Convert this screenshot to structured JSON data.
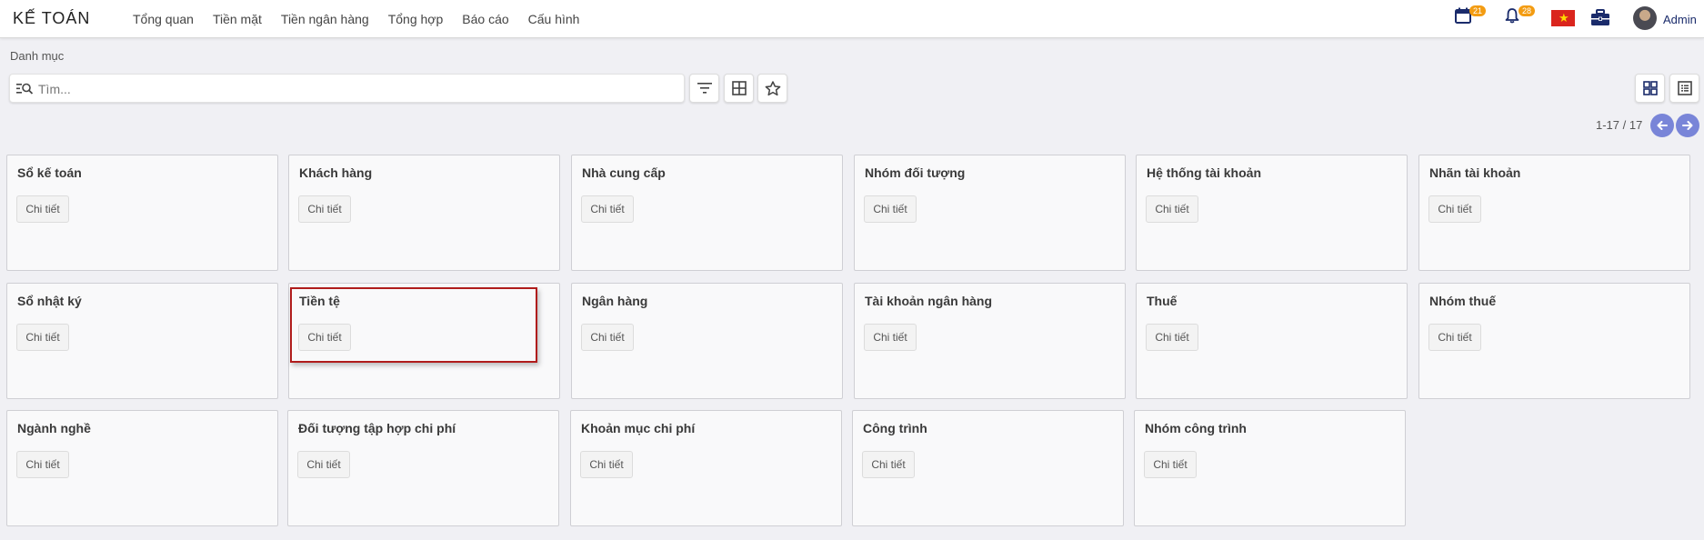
{
  "app": {
    "title": "KẾ TOÁN"
  },
  "menu": [
    {
      "label": "Tổng quan"
    },
    {
      "label": "Tiền mặt"
    },
    {
      "label": "Tiền ngân hàng"
    },
    {
      "label": "Tổng hợp"
    },
    {
      "label": "Báo cáo"
    },
    {
      "label": "Cấu hình"
    }
  ],
  "header_right": {
    "calendar_badge": "21",
    "notification_badge": "28",
    "user_name": "Admin",
    "icons": [
      "calendar-icon",
      "bell-icon",
      "vietnam-flag-icon",
      "briefcase-icon",
      "avatar"
    ]
  },
  "breadcrumb": "Danh mục",
  "search": {
    "placeholder": "Tìm...",
    "value": ""
  },
  "pager": {
    "text": "1-17 / 17"
  },
  "cards": [
    {
      "title": "Sổ kế toán",
      "button": "Chi tiết"
    },
    {
      "title": "Khách hàng",
      "button": "Chi tiết"
    },
    {
      "title": "Nhà cung cấp",
      "button": "Chi tiết"
    },
    {
      "title": "Nhóm đối tượng",
      "button": "Chi tiết"
    },
    {
      "title": "Hệ thống tài khoản",
      "button": "Chi tiết"
    },
    {
      "title": "Nhãn tài khoản",
      "button": "Chi tiết"
    },
    {
      "title": "Sổ nhật ký",
      "button": "Chi tiết"
    },
    {
      "title": "Tiền tệ",
      "button": "Chi tiết"
    },
    {
      "title": "Ngân hàng",
      "button": "Chi tiết"
    },
    {
      "title": "Tài khoản ngân hàng",
      "button": "Chi tiết"
    },
    {
      "title": "Thuế",
      "button": "Chi tiết"
    },
    {
      "title": "Nhóm thuế",
      "button": "Chi tiết"
    },
    {
      "title": "Ngành nghề",
      "button": "Chi tiết"
    },
    {
      "title": "Đối tượng tập hợp chi phí",
      "button": "Chi tiết"
    },
    {
      "title": "Khoản mục chi phí",
      "button": "Chi tiết"
    },
    {
      "title": "Công trình",
      "button": "Chi tiết"
    },
    {
      "title": "Nhóm công trình",
      "button": "Chi tiết"
    }
  ],
  "colors": {
    "accent": "#7985d8",
    "badge": "#f39c12",
    "highlight": "#b01c1c",
    "brand_dark": "#1a2b6b"
  }
}
